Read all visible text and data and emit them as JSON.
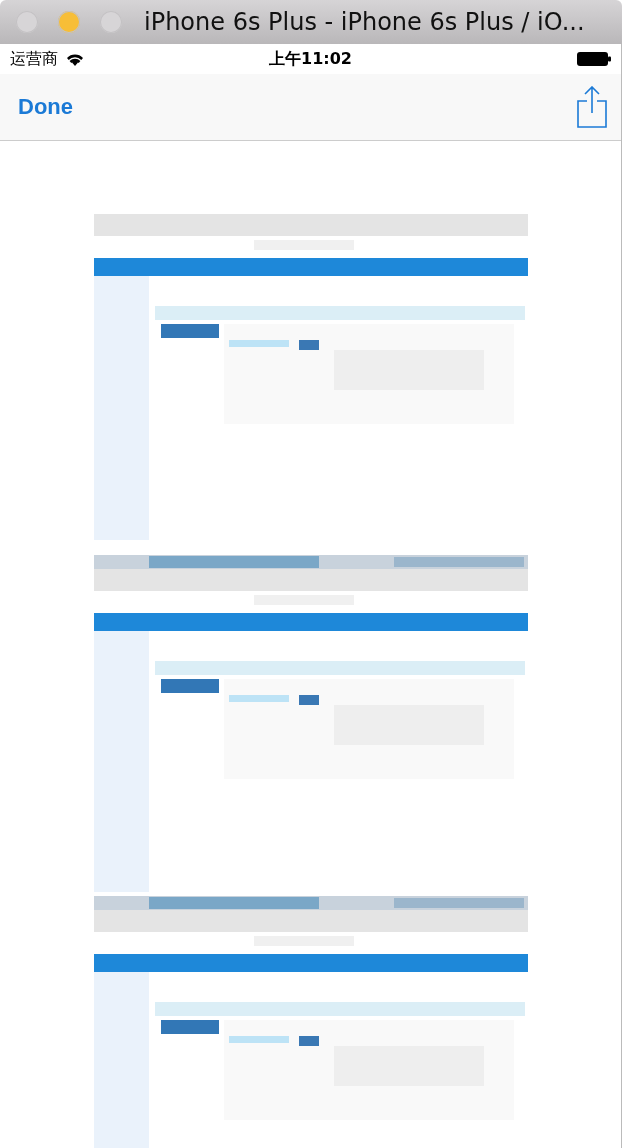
{
  "window": {
    "title": "iPhone 6s Plus - iPhone 6s Plus / iO..."
  },
  "status_bar": {
    "carrier": "运营商",
    "time": "上午11:02"
  },
  "nav_bar": {
    "done": "Done"
  }
}
